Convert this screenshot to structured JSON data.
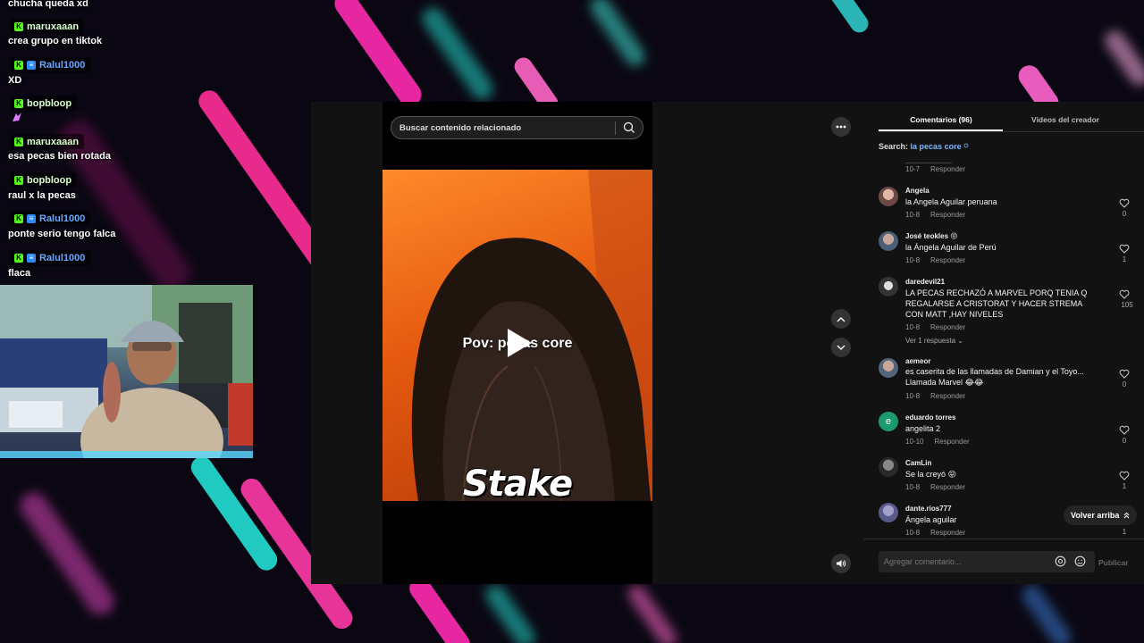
{
  "chat": {
    "top_text": "chucha queda xd",
    "messages": [
      {
        "user": "maruxaaan",
        "text": "crea grupo en tiktok"
      },
      {
        "user": "Ralul1000",
        "text": "XD"
      },
      {
        "user": "bopbloop",
        "text": ""
      },
      {
        "user": "maruxaaan",
        "text": "esa pecas bien rotada"
      },
      {
        "user": "bopbloop",
        "text": "raul x la pecas"
      },
      {
        "user": "Ralul1000",
        "text": "ponte serio tengo falca"
      },
      {
        "user": "Ralul1000",
        "text": "flaca"
      }
    ],
    "badge_k": "K",
    "badge_b": "≡"
  },
  "video": {
    "search_placeholder": "Buscar contenido relacionado",
    "caption": "Pov: pecas core",
    "sponsor": "Stake"
  },
  "panel": {
    "tab_comments": "Comentarios (96)",
    "tab_videos": "Videos del creador",
    "search_label": "Search:",
    "search_term": "la pecas core",
    "prev_meta": {
      "date": "10-7",
      "reply": "Responder"
    },
    "comments": [
      {
        "user": "Angela",
        "text": "la Angela Aguilar peruana",
        "date": "10-8",
        "reply": "Responder",
        "likes": "0"
      },
      {
        "user": "José teokles 😝",
        "text": "la Ángela Aguilar de Perú",
        "date": "10-8",
        "reply": "Responder",
        "likes": "1"
      },
      {
        "user": "daredevil21",
        "text": "LA PECAS RECHAZÓ A MARVEL PORQ TENIA Q REGALARSE A CRISTORAT Y HACER STREMA CON MATT ,HAY NIVELES",
        "date": "10-8",
        "reply": "Responder",
        "likes": "105",
        "replies": "Ver 1 respuesta ⌄"
      },
      {
        "user": "aemeor",
        "text": "es caserita de las llamadas de Damian y el Toyo... Llamada Marvel 😂😂",
        "date": "10-8",
        "reply": "Responder",
        "likes": "0"
      },
      {
        "user": "eduardo torres",
        "text": "angelita 2",
        "date": "10-10",
        "reply": "Responder",
        "likes": "0",
        "avatar_letter": "e"
      },
      {
        "user": "CamLin",
        "text": "Se la creyó 😝",
        "date": "10-8",
        "reply": "Responder",
        "likes": "1"
      },
      {
        "user": "dante.rios777",
        "text": "Ángela aguilar",
        "date": "10-8",
        "reply": "Responder",
        "likes": "1"
      }
    ],
    "back_to_top": "Volver arriba",
    "comment_placeholder": "Agregar comentario...",
    "publish": "Publicar"
  }
}
